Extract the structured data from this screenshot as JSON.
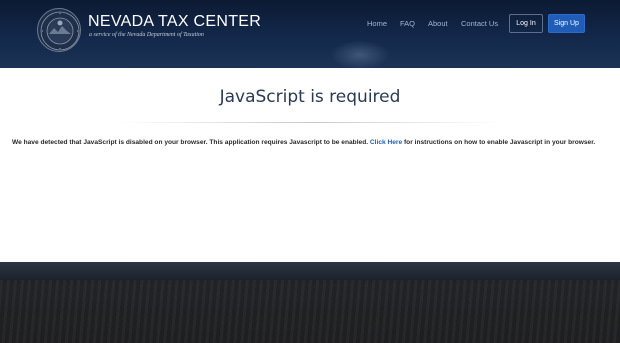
{
  "header": {
    "brand_title": "NEVADA TAX CENTER",
    "brand_subtitle": "a service of the Nevada Department of Taxation",
    "logo_icon": "nevada-state-seal-icon",
    "nav": {
      "home": "Home",
      "faq": "FAQ",
      "about": "About",
      "contact": "Contact Us"
    },
    "login_label": "Log In",
    "signup_label": "Sign Up"
  },
  "main": {
    "heading": "JavaScript is required",
    "message_before": "We have detected that JavaScript is disabled on your browser. This application requires Javascript to be enabled. ",
    "message_link": "Click Here",
    "message_after": " for instructions on how to enable Javascript in your browser."
  },
  "colors": {
    "header_bg": "#13284a",
    "accent": "#1f5db8",
    "nav_text": "#9fb4d4",
    "heading_text": "#2a3a55"
  }
}
